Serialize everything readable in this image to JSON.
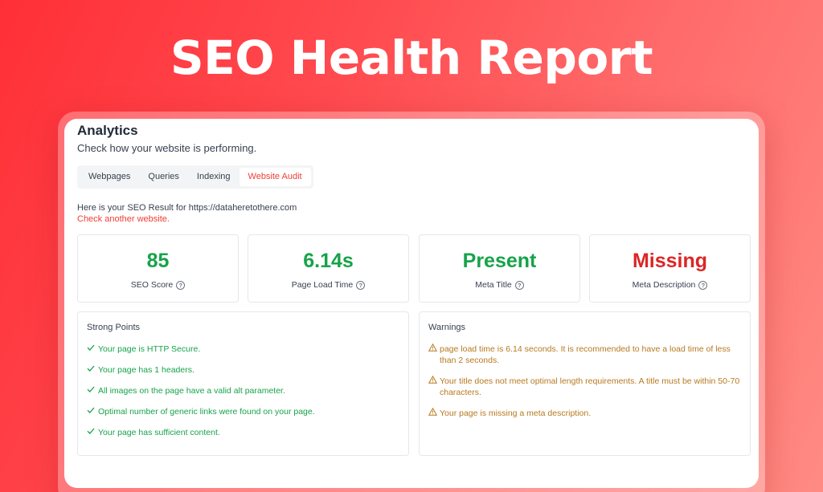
{
  "hero": {
    "title": "SEO Health Report"
  },
  "panel": {
    "title": "Analytics",
    "subtitle": "Check how your website is performing.",
    "tabs": [
      {
        "label": "Webpages"
      },
      {
        "label": "Queries"
      },
      {
        "label": "Indexing"
      },
      {
        "label": "Website Audit",
        "active": true
      }
    ],
    "result_line": "Here is your SEO Result for https://dataheretothere.com",
    "check_another": "Check another website."
  },
  "metrics": [
    {
      "value": "85",
      "label": "SEO Score",
      "color": "#16a34a"
    },
    {
      "value": "6.14s",
      "label": "Page Load Time",
      "color": "#16a34a"
    },
    {
      "value": "Present",
      "label": "Meta Title",
      "color": "#16a34a"
    },
    {
      "value": "Missing",
      "label": "Meta Description",
      "color": "#dc2626"
    }
  ],
  "strong_points": {
    "title": "Strong Points",
    "icon": "check-icon",
    "items": [
      "Your page is HTTP Secure.",
      "Your page has 1 headers.",
      "All images on the page have a valid alt parameter.",
      "Optimal number of generic links were found on your page.",
      "Your page has sufficient content."
    ]
  },
  "warnings": {
    "title": "Warnings",
    "icon": "warning-triangle-icon",
    "items": [
      "page load time is 6.14 seconds. It is recommended to have a load time of less than 2 seconds.",
      "Your title does not meet optimal length requirements. A title must be within 50-70 characters.",
      "Your page is missing a meta description."
    ]
  }
}
